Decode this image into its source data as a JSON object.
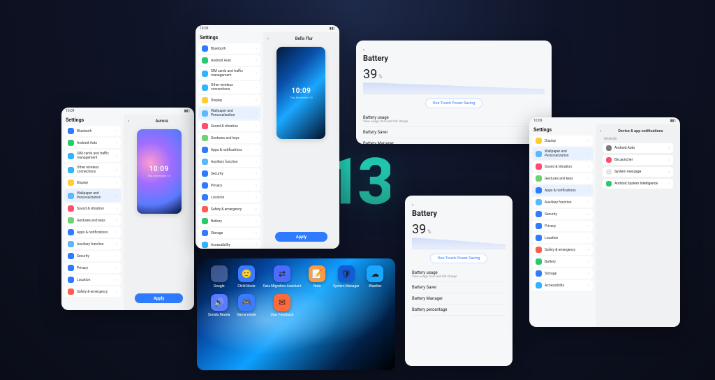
{
  "logo": "13",
  "status": {
    "time": "10:09",
    "signal": "▮▮▯"
  },
  "sidebar_title": "Settings",
  "settings_items": [
    {
      "label": "Bluetooth",
      "color": "#2f7bff"
    },
    {
      "label": "Android Auto",
      "color": "#2ac96d"
    },
    {
      "label": "SIM cards and traffic management",
      "color": "#2fb4ff"
    },
    {
      "label": "Other wireless connections",
      "color": "#2fb4ff"
    },
    {
      "label": "Display",
      "color": "#ffcc33"
    },
    {
      "label": "Wallpaper and Personalization",
      "color": "#5bb8ff",
      "selected": true
    },
    {
      "label": "Sound & vibration",
      "color": "#ff4d6d"
    },
    {
      "label": "Gestures and keys",
      "color": "#6ed36e"
    },
    {
      "label": "Apps & notifications",
      "color": "#2f7bff"
    },
    {
      "label": "Auxiliary function",
      "color": "#5bb8ff"
    },
    {
      "label": "Security",
      "color": "#2f7bff"
    },
    {
      "label": "Privacy",
      "color": "#2f7bff"
    },
    {
      "label": "Location",
      "color": "#2f7bff"
    },
    {
      "label": "Safety & emergency",
      "color": "#ff5c4d"
    }
  ],
  "panel1": {
    "title": "Aurora",
    "lock_time": "10:09",
    "lock_date": "Thu, November 10",
    "apply": "Apply"
  },
  "panel2_extra": [
    {
      "label": "Battery",
      "color": "#2ac96d"
    },
    {
      "label": "Storage",
      "color": "#2f7bff"
    },
    {
      "label": "Accessibility",
      "color": "#2fb4ff"
    }
  ],
  "panel2": {
    "title": "Bella Flur",
    "lock_time": "10:09",
    "lock_date": "Thu, November 10",
    "apply": "Apply"
  },
  "battery": {
    "title": "Battery",
    "percent": "39",
    "percent_suffix": "%",
    "button": "One-Touch Power Saving",
    "rows": [
      {
        "title": "Battery usage",
        "sub": "View usage from last full charge"
      },
      {
        "title": "Battery Saver",
        "sub": ""
      },
      {
        "title": "Battery Manager",
        "sub": ""
      },
      {
        "title": "Battery percentage",
        "sub": ""
      }
    ]
  },
  "home": {
    "apps": [
      {
        "label": "Google",
        "type": "folder"
      },
      {
        "label": "Child Mode",
        "color": "#3a7bff",
        "glyph": "🙂"
      },
      {
        "label": "Data Migration Assistant",
        "color": "#4e6bff",
        "glyph": "⇄"
      },
      {
        "label": "Note",
        "color": "#ff9a3d",
        "glyph": "📝"
      },
      {
        "label": "System Manager",
        "color": "#145bd8",
        "glyph": "🛡"
      },
      {
        "label": "Weather",
        "color": "#1aa7ff",
        "glyph": "☁"
      },
      {
        "label": "Sonido Revela",
        "color": "#5b7bff",
        "glyph": "🔊"
      },
      {
        "label": "Game mode",
        "color": "#3a7bff",
        "glyph": "🎮"
      },
      {
        "label": "User Feedback",
        "color": "#ff6a3d",
        "glyph": "✉"
      }
    ]
  },
  "notif": {
    "header": "Device & app notifications",
    "section": "MANAGE",
    "items": [
      {
        "label": "Android Auto",
        "color": "#7a7a7a"
      },
      {
        "label": "BxLauncher",
        "color": "#ff4d6d"
      },
      {
        "label": "System message",
        "color": "#e5e5e5"
      },
      {
        "label": "Android System Intelligence",
        "color": "#2ac96d"
      }
    ],
    "sidebar_apps_sel": 8
  }
}
